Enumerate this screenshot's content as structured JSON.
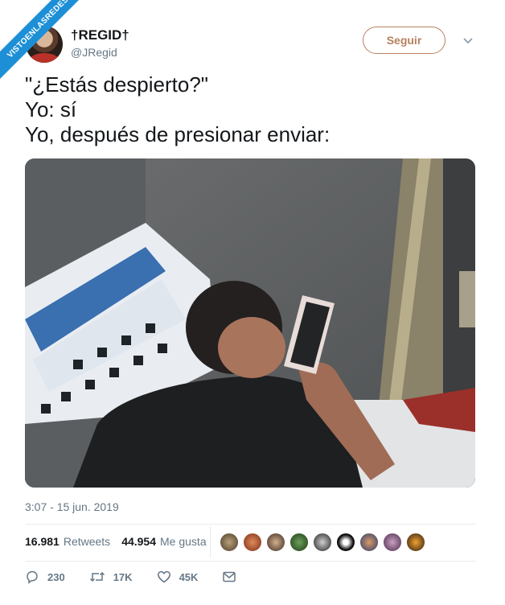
{
  "watermark": "VISTOENLASREDES",
  "author": {
    "display_name": "†REGID†",
    "handle": "@JRegid"
  },
  "follow_label": "Seguir",
  "tweet_lines": [
    "\"¿Estás despierto?\"",
    "Yo: sí",
    "Yo, después de presionar enviar:"
  ],
  "timestamp": "3:07 - 15 jun. 2019",
  "stats": {
    "retweets_count": "16.981",
    "retweets_label": "Retweets",
    "likes_count": "44.954",
    "likes_label": "Me gusta"
  },
  "actions": {
    "replies": "230",
    "retweets": "17K",
    "likes": "45K"
  },
  "colors": {
    "watermark_bg": "#1c8fd6",
    "follow_accent": "#b6815f",
    "muted_text": "#657786"
  }
}
